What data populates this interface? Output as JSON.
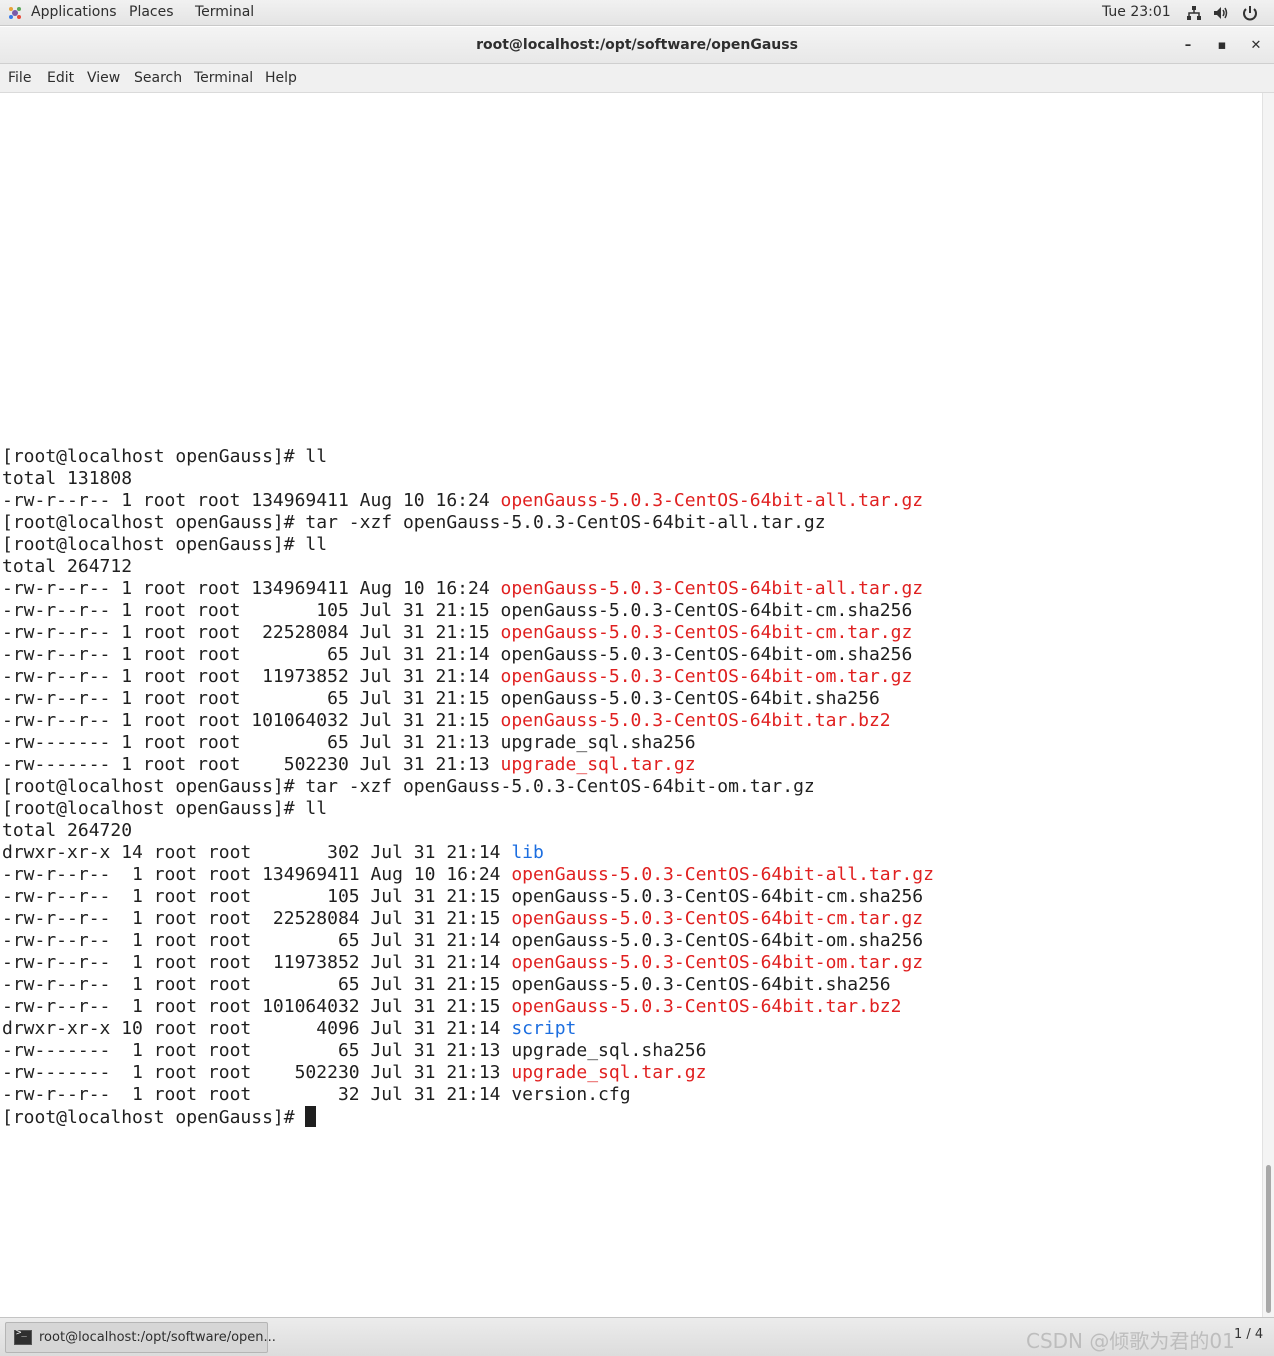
{
  "top_panel": {
    "applications": "Applications",
    "places": "Places",
    "terminal": "Terminal",
    "clock": "Tue 23:01",
    "icons": [
      "network-icon",
      "volume-icon",
      "power-icon"
    ]
  },
  "window": {
    "title": "root@localhost:/opt/software/openGauss",
    "minimize": "–",
    "maximize": "▪",
    "close": "✕"
  },
  "menu": {
    "file": "File",
    "edit": "Edit",
    "view": "View",
    "search": "Search",
    "terminal": "Terminal",
    "help": "Help"
  },
  "colors": {
    "archive": "#e02020",
    "directory": "#1c6ee0",
    "text": "#1f1f1f"
  },
  "terminal": {
    "lines": [
      [
        {
          "t": "[root@localhost openGauss]# ll"
        }
      ],
      [
        {
          "t": "total 131808"
        }
      ],
      [
        {
          "t": "-rw-r--r-- 1 root root 134969411 Aug 10 16:24 "
        },
        {
          "t": "openGauss-5.0.3-CentOS-64bit-all.tar.gz",
          "c": "red"
        }
      ],
      [
        {
          "t": "[root@localhost openGauss]# tar -xzf openGauss-5.0.3-CentOS-64bit-all.tar.gz"
        }
      ],
      [
        {
          "t": "[root@localhost openGauss]# ll"
        }
      ],
      [
        {
          "t": "total 264712"
        }
      ],
      [
        {
          "t": "-rw-r--r-- 1 root root 134969411 Aug 10 16:24 "
        },
        {
          "t": "openGauss-5.0.3-CentOS-64bit-all.tar.gz",
          "c": "red"
        }
      ],
      [
        {
          "t": "-rw-r--r-- 1 root root       105 Jul 31 21:15 openGauss-5.0.3-CentOS-64bit-cm.sha256"
        }
      ],
      [
        {
          "t": "-rw-r--r-- 1 root root  22528084 Jul 31 21:15 "
        },
        {
          "t": "openGauss-5.0.3-CentOS-64bit-cm.tar.gz",
          "c": "red"
        }
      ],
      [
        {
          "t": "-rw-r--r-- 1 root root        65 Jul 31 21:14 openGauss-5.0.3-CentOS-64bit-om.sha256"
        }
      ],
      [
        {
          "t": "-rw-r--r-- 1 root root  11973852 Jul 31 21:14 "
        },
        {
          "t": "openGauss-5.0.3-CentOS-64bit-om.tar.gz",
          "c": "red"
        }
      ],
      [
        {
          "t": "-rw-r--r-- 1 root root        65 Jul 31 21:15 openGauss-5.0.3-CentOS-64bit.sha256"
        }
      ],
      [
        {
          "t": "-rw-r--r-- 1 root root 101064032 Jul 31 21:15 "
        },
        {
          "t": "openGauss-5.0.3-CentOS-64bit.tar.bz2",
          "c": "red"
        }
      ],
      [
        {
          "t": "-rw------- 1 root root        65 Jul 31 21:13 upgrade_sql.sha256"
        }
      ],
      [
        {
          "t": "-rw------- 1 root root    502230 Jul 31 21:13 "
        },
        {
          "t": "upgrade_sql.tar.gz",
          "c": "red"
        }
      ],
      [
        {
          "t": "[root@localhost openGauss]# tar -xzf openGauss-5.0.3-CentOS-64bit-om.tar.gz"
        }
      ],
      [
        {
          "t": "[root@localhost openGauss]# ll"
        }
      ],
      [
        {
          "t": "total 264720"
        }
      ],
      [
        {
          "t": "drwxr-xr-x 14 root root       302 Jul 31 21:14 "
        },
        {
          "t": "lib",
          "c": "blue"
        }
      ],
      [
        {
          "t": "-rw-r--r--  1 root root 134969411 Aug 10 16:24 "
        },
        {
          "t": "openGauss-5.0.3-CentOS-64bit-all.tar.gz",
          "c": "red"
        }
      ],
      [
        {
          "t": "-rw-r--r--  1 root root       105 Jul 31 21:15 openGauss-5.0.3-CentOS-64bit-cm.sha256"
        }
      ],
      [
        {
          "t": "-rw-r--r--  1 root root  22528084 Jul 31 21:15 "
        },
        {
          "t": "openGauss-5.0.3-CentOS-64bit-cm.tar.gz",
          "c": "red"
        }
      ],
      [
        {
          "t": "-rw-r--r--  1 root root        65 Jul 31 21:14 openGauss-5.0.3-CentOS-64bit-om.sha256"
        }
      ],
      [
        {
          "t": "-rw-r--r--  1 root root  11973852 Jul 31 21:14 "
        },
        {
          "t": "openGauss-5.0.3-CentOS-64bit-om.tar.gz",
          "c": "red"
        }
      ],
      [
        {
          "t": "-rw-r--r--  1 root root        65 Jul 31 21:15 openGauss-5.0.3-CentOS-64bit.sha256"
        }
      ],
      [
        {
          "t": "-rw-r--r--  1 root root 101064032 Jul 31 21:15 "
        },
        {
          "t": "openGauss-5.0.3-CentOS-64bit.tar.bz2",
          "c": "red"
        }
      ],
      [
        {
          "t": "drwxr-xr-x 10 root root      4096 Jul 31 21:14 "
        },
        {
          "t": "script",
          "c": "blue"
        }
      ],
      [
        {
          "t": "-rw-------  1 root root        65 Jul 31 21:13 upgrade_sql.sha256"
        }
      ],
      [
        {
          "t": "-rw-------  1 root root    502230 Jul 31 21:13 "
        },
        {
          "t": "upgrade_sql.tar.gz",
          "c": "red"
        }
      ],
      [
        {
          "t": "-rw-r--r--  1 root root        32 Jul 31 21:14 version.cfg"
        }
      ],
      [
        {
          "t": "[root@localhost openGauss]# "
        },
        {
          "cursor": true
        }
      ]
    ]
  },
  "taskbar": {
    "task_label": "root@localhost:/opt/software/open...",
    "watermark": "CSDN @倾歌为君的01",
    "pager": "1 / 4"
  }
}
